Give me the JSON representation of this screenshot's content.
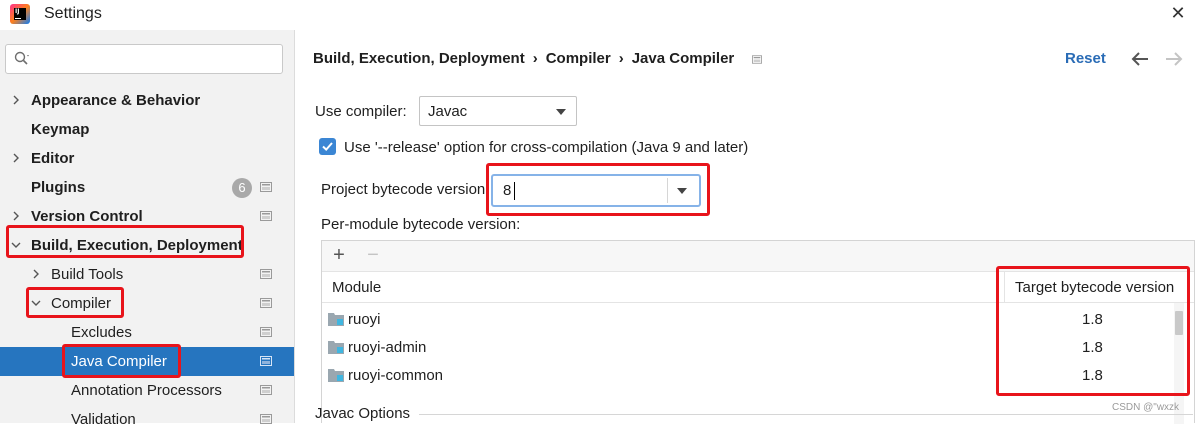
{
  "window": {
    "title": "Settings"
  },
  "sidebar": {
    "search_placeholder": "",
    "items": [
      {
        "label": "Appearance & Behavior"
      },
      {
        "label": "Keymap"
      },
      {
        "label": "Editor"
      },
      {
        "label": "Plugins",
        "badge": "6"
      },
      {
        "label": "Version Control"
      },
      {
        "label": "Build, Execution, Deployment"
      },
      {
        "label": "Build Tools"
      },
      {
        "label": "Compiler"
      },
      {
        "label": "Excludes"
      },
      {
        "label": "Java Compiler"
      },
      {
        "label": "Annotation Processors"
      },
      {
        "label": "Validation"
      }
    ]
  },
  "header": {
    "crumbs": [
      "Build, Execution, Deployment",
      "Compiler",
      "Java Compiler"
    ],
    "separator": "›",
    "reset_label": "Reset"
  },
  "form": {
    "use_compiler_label": "Use compiler:",
    "use_compiler_value": "Javac",
    "release_option_label": "Use '--release' option for cross-compilation (Java 9 and later)",
    "release_option_checked": true,
    "project_bytecode_label": "Project bytecode version",
    "project_bytecode_value": "8",
    "per_module_label": "Per-module bytecode version:"
  },
  "table": {
    "add_label": "+",
    "remove_label": "−",
    "columns": [
      "Module",
      "Target bytecode version"
    ],
    "rows": [
      {
        "module": "ruoyi",
        "target": "1.8"
      },
      {
        "module": "ruoyi-admin",
        "target": "1.8"
      },
      {
        "module": "ruoyi-common",
        "target": "1.8"
      }
    ]
  },
  "footer": {
    "javac_options_label": "Javac Options"
  },
  "watermark": "CSDN @\"wxzk"
}
